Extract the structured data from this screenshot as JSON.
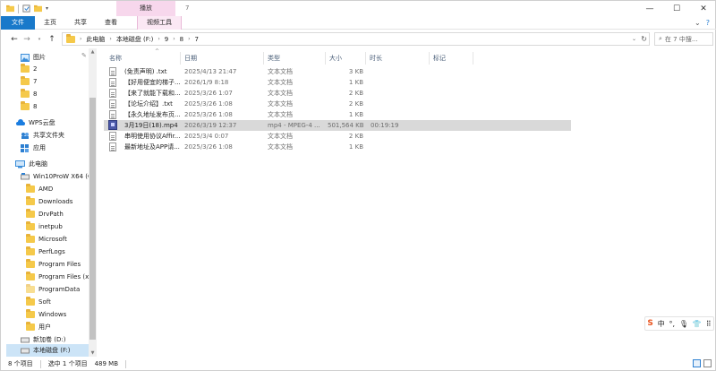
{
  "window": {
    "context_tab_header": "播放",
    "title": "7",
    "buttons": {
      "minimize": "—",
      "maximize": "☐",
      "close": "✕"
    }
  },
  "ribbon": {
    "tabs": [
      "文件",
      "主页",
      "共享",
      "查看"
    ],
    "context_tab": "视频工具"
  },
  "address": {
    "crumbs": [
      "此电脑",
      "本地磁盘 (F:)",
      "9",
      "8",
      "7"
    ],
    "search_placeholder": "在 7 中搜..."
  },
  "nav_pane": {
    "quick_items": [
      {
        "label": "图片",
        "icon": "picture-icon"
      },
      {
        "label": "2",
        "icon": "folder-icon"
      },
      {
        "label": "7",
        "icon": "folder-icon"
      },
      {
        "label": "8",
        "icon": "folder-icon"
      },
      {
        "label": "8",
        "icon": "folder-icon"
      }
    ],
    "wps": "WPS云盘",
    "wps_children": [
      "共享文件夹",
      "应用"
    ],
    "this_pc": "此电脑",
    "drive_c": "Win10ProW X64 (C",
    "c_folders": [
      "AMD",
      "Downloads",
      "DrvPath",
      "inetpub",
      "Microsoft",
      "PerfLogs",
      "Program Files",
      "Program Files (x8",
      "ProgramData",
      "Soft",
      "Windows",
      "用户"
    ],
    "drive_d": "新加卷 (D:)",
    "drive_f": "本地磁盘 (F:)"
  },
  "columns": [
    "名称",
    "日期",
    "类型",
    "大小",
    "时长",
    "标记"
  ],
  "files": [
    {
      "name": "(免责声明) .txt",
      "date": "2025/4/13 21:47",
      "type": "文本文档",
      "size": "3 KB",
      "duration": "",
      "kind": "txt"
    },
    {
      "name": "【好用便宜的梯子...",
      "date": "2026/1/9 8:18",
      "type": "文本文档",
      "size": "1 KB",
      "duration": "",
      "kind": "txt"
    },
    {
      "name": "【来了就能下载和...",
      "date": "2025/3/26 1:07",
      "type": "文本文档",
      "size": "2 KB",
      "duration": "",
      "kind": "txt"
    },
    {
      "name": "【论坛介绍】.txt",
      "date": "2025/3/26 1:08",
      "type": "文本文档",
      "size": "2 KB",
      "duration": "",
      "kind": "txt"
    },
    {
      "name": "【永久地址发布页...",
      "date": "2025/3/26 1:08",
      "type": "文本文档",
      "size": "1 KB",
      "duration": "",
      "kind": "txt"
    },
    {
      "name": "3月19日(18).mp4",
      "date": "2026/3/19 12:37",
      "type": "mp4 - MPEG-4 ...",
      "size": "501,564 KB",
      "duration": "00:19:19",
      "kind": "mp4"
    },
    {
      "name": "串明使用协议Affir...",
      "date": "2025/3/4 0:07",
      "type": "文本文档",
      "size": "2 KB",
      "duration": "",
      "kind": "txt"
    },
    {
      "name": "最新地址及APP请...",
      "date": "2025/3/26 1:08",
      "type": "文本文档",
      "size": "1 KB",
      "duration": "",
      "kind": "txt"
    }
  ],
  "status": {
    "count": "8 个项目",
    "selected": "选中 1 个项目",
    "size": "489 MB"
  },
  "ime": {
    "logo": "S",
    "mode": "中"
  }
}
